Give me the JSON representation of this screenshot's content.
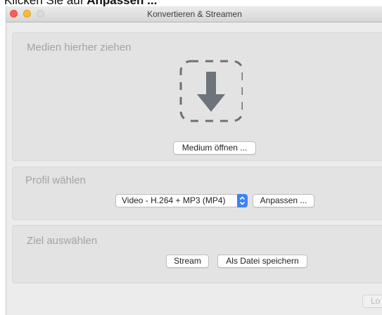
{
  "caption": {
    "lead": "Klicken Sie auf ",
    "strong": "Anpassen ..."
  },
  "window": {
    "title": "Konvertieren & Streamen"
  },
  "media": {
    "heading": "Medien hierher ziehen",
    "open_button": "Medium öffnen ...",
    "drop_icon": "download-arrow-icon"
  },
  "profile": {
    "heading": "Profil wählen",
    "selected": "Video - H.264 + MP3 (MP4)",
    "customize_button": "Anpassen ..."
  },
  "destination": {
    "heading": "Ziel auswählen",
    "stream_button": "Stream",
    "save_button": "Als Datei speichern"
  },
  "footer": {
    "start_button": "Lo"
  },
  "colors": {
    "close": "#fc5f57",
    "minimize": "#fdbc2e",
    "stepper": "#3b82f7",
    "arrow": "#6e737c"
  }
}
